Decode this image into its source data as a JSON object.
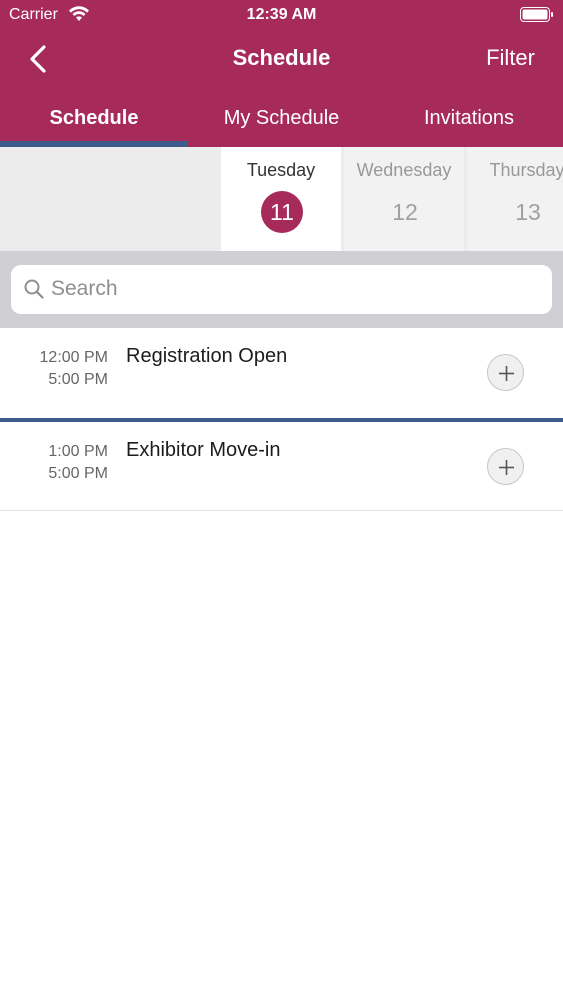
{
  "status_bar": {
    "carrier": "Carrier",
    "time": "12:39 AM"
  },
  "nav": {
    "title": "Schedule",
    "filter_label": "Filter",
    "back_icon": "chevron-left-icon"
  },
  "tabs": [
    {
      "label": "Schedule",
      "selected": true
    },
    {
      "label": "My Schedule",
      "selected": false
    },
    {
      "label": "Invitations",
      "selected": false
    }
  ],
  "dates": [
    {
      "day": "Tuesday",
      "number": "11",
      "selected": true
    },
    {
      "day": "Wednesday",
      "number": "12",
      "selected": false
    },
    {
      "day": "Thursday",
      "number": "13",
      "selected": false
    }
  ],
  "search": {
    "placeholder": "Search",
    "value": ""
  },
  "events": [
    {
      "start": "12:00 PM",
      "end": "5:00 PM",
      "title": "Registration Open"
    },
    {
      "start": "1:00 PM",
      "end": "5:00 PM",
      "title": "Exhibitor Move-in"
    }
  ],
  "colors": {
    "brand": "#a62a5a",
    "accent_underline": "#3d5c8c"
  }
}
